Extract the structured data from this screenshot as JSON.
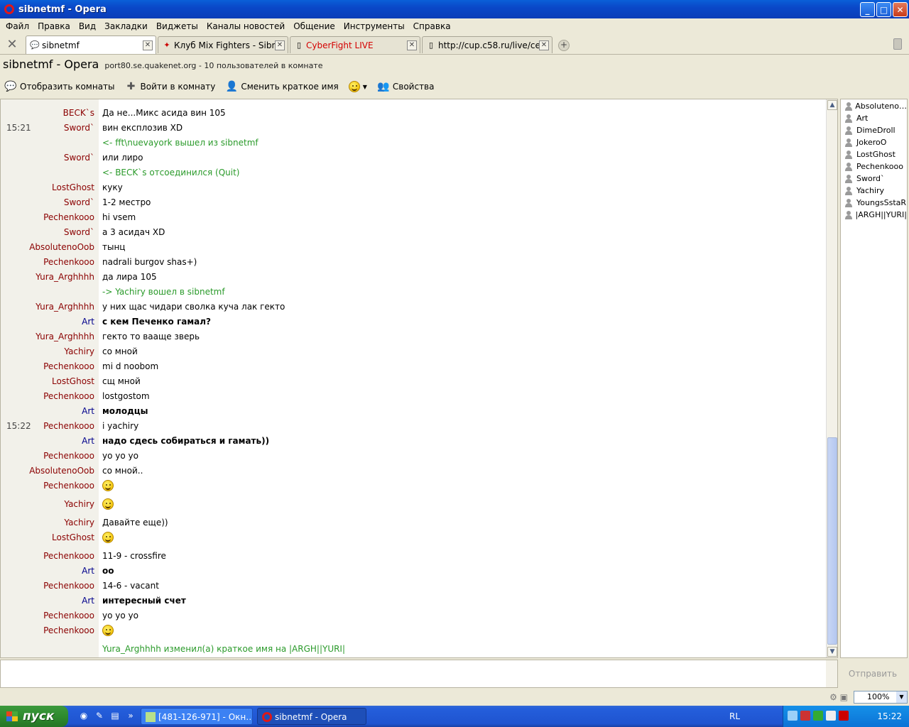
{
  "window": {
    "title": "sibnetmf - Opera"
  },
  "menu": [
    "Файл",
    "Правка",
    "Вид",
    "Закладки",
    "Виджеты",
    "Каналы новостей",
    "Общение",
    "Инструменты",
    "Справка"
  ],
  "tabs": [
    {
      "label": "sibnetmf",
      "icon": "chat-bubble-icon",
      "active": true
    },
    {
      "label": "Клуб Mix Fighters - Sibnet…",
      "icon": "site-favicon-icon",
      "active": false
    },
    {
      "label": "CyberFight LIVE",
      "icon": "page-icon",
      "active": false,
      "color": "#d40000"
    },
    {
      "label": "http://cup.c58.ru/live/cen…",
      "icon": "page-icon",
      "active": false
    }
  ],
  "header": {
    "title": "sibnetmf - Opera",
    "subtitle": "port80.se.quakenet.org - 10 пользователей в комнате"
  },
  "toolbar": {
    "show_rooms": "Отобразить комнаты",
    "join_room": "Войти в комнату",
    "change_nick": "Сменить краткое имя",
    "properties": "Свойства"
  },
  "chat": [
    {
      "time": "",
      "nick": "BECK`s",
      "msg": "Да не...Микс асида вин 105",
      "kind": "normal"
    },
    {
      "time": "15:21",
      "nick": "Sword`",
      "msg": "вин експлозив XD",
      "kind": "normal"
    },
    {
      "time": "",
      "nick": "",
      "msg": "<- fft\\nuevayork вышел из sibnetmf",
      "kind": "sys"
    },
    {
      "time": "",
      "nick": "Sword`",
      "msg": "или лиро",
      "kind": "normal"
    },
    {
      "time": "",
      "nick": "",
      "msg": "<- BECK`s отсоединился (Quit)",
      "kind": "sys"
    },
    {
      "time": "",
      "nick": "LostGhost",
      "msg": "куку",
      "kind": "normal"
    },
    {
      "time": "",
      "nick": "Sword`",
      "msg": "1-2 местро",
      "kind": "normal"
    },
    {
      "time": "",
      "nick": "Pechenkooo",
      "msg": "hi vsem",
      "kind": "normal"
    },
    {
      "time": "",
      "nick": "Sword`",
      "msg": "а 3 асидач XD",
      "kind": "normal"
    },
    {
      "time": "",
      "nick": "AbsolutenoOob",
      "msg": "тынц",
      "kind": "normal"
    },
    {
      "time": "",
      "nick": "Pechenkooo",
      "msg": "nadrali burgov shas+)",
      "kind": "normal"
    },
    {
      "time": "",
      "nick": "Yura_Arghhhh",
      "msg": "да лира 105",
      "kind": "normal"
    },
    {
      "time": "",
      "nick": "",
      "msg": "-> Yachiry вошел в sibnetmf",
      "kind": "sys"
    },
    {
      "time": "",
      "nick": "Yura_Arghhhh",
      "msg": "у них щас чидари сволка куча лак гекто",
      "kind": "normal"
    },
    {
      "time": "",
      "nick": "Art",
      "msg": "с кем Печенко гамал?",
      "kind": "bold"
    },
    {
      "time": "",
      "nick": "Yura_Arghhhh",
      "msg": "гекто то вааще зверь",
      "kind": "normal"
    },
    {
      "time": "",
      "nick": "Yachiry",
      "msg": "со мной",
      "kind": "normal"
    },
    {
      "time": "",
      "nick": "Pechenkooo",
      "msg": "mi d noobom",
      "kind": "normal"
    },
    {
      "time": "",
      "nick": "LostGhost",
      "msg": "сщ мной",
      "kind": "normal"
    },
    {
      "time": "",
      "nick": "Pechenkooo",
      "msg": "lostgostom",
      "kind": "normal"
    },
    {
      "time": "",
      "nick": "Art",
      "msg": "молодцы",
      "kind": "bold"
    },
    {
      "time": "15:22",
      "nick": "Pechenkooo",
      "msg": "i yachiry",
      "kind": "normal"
    },
    {
      "time": "",
      "nick": "Art",
      "msg": "надо сдесь собираться и гамать))",
      "kind": "bold"
    },
    {
      "time": "",
      "nick": "Pechenkooo",
      "msg": "yo yo yo",
      "kind": "normal"
    },
    {
      "time": "",
      "nick": "AbsolutenoOob",
      "msg": "со мной..",
      "kind": "normal"
    },
    {
      "time": "",
      "nick": "Pechenkooo",
      "msg": "",
      "kind": "smiley"
    },
    {
      "time": "",
      "nick": "Yachiry",
      "msg": "",
      "kind": "smiley"
    },
    {
      "time": "",
      "nick": "Yachiry",
      "msg": "Давайте еще))",
      "kind": "normal"
    },
    {
      "time": "",
      "nick": "LostGhost",
      "msg": "",
      "kind": "smiley"
    },
    {
      "time": "",
      "nick": "Pechenkooo",
      "msg": "11-9 - crossfire",
      "kind": "normal"
    },
    {
      "time": "",
      "nick": "Art",
      "msg": "оо",
      "kind": "bold"
    },
    {
      "time": "",
      "nick": "Pechenkooo",
      "msg": "14-6 - vacant",
      "kind": "normal"
    },
    {
      "time": "",
      "nick": "Art",
      "msg": "интересный счет",
      "kind": "bold"
    },
    {
      "time": "",
      "nick": "Pechenkooo",
      "msg": "yo yo yo",
      "kind": "normal"
    },
    {
      "time": "",
      "nick": "Pechenkooo",
      "msg": "",
      "kind": "smiley"
    },
    {
      "time": "",
      "nick": "",
      "msg": "Yura_Arghhhh изменил(а) краткое имя на |ARGH||YURI|",
      "kind": "sys"
    }
  ],
  "users": [
    "Absoluteno…",
    "Art",
    "DimeDroll",
    "JokeroO",
    "LostGhost",
    "Pechenkooo",
    "Sword`",
    "Yachiry",
    "YoungsSstaR",
    "|ARGH||YURI|"
  ],
  "input": {
    "send_label": "Отправить"
  },
  "status": {
    "zoom": "100%"
  },
  "taskbar": {
    "start": "пуск",
    "tasks": [
      {
        "label": "[481-126-971] - Окн…",
        "active": false
      },
      {
        "label": "sibnetmf - Opera",
        "active": true
      }
    ],
    "lang": "RL",
    "clock": "15:22"
  }
}
